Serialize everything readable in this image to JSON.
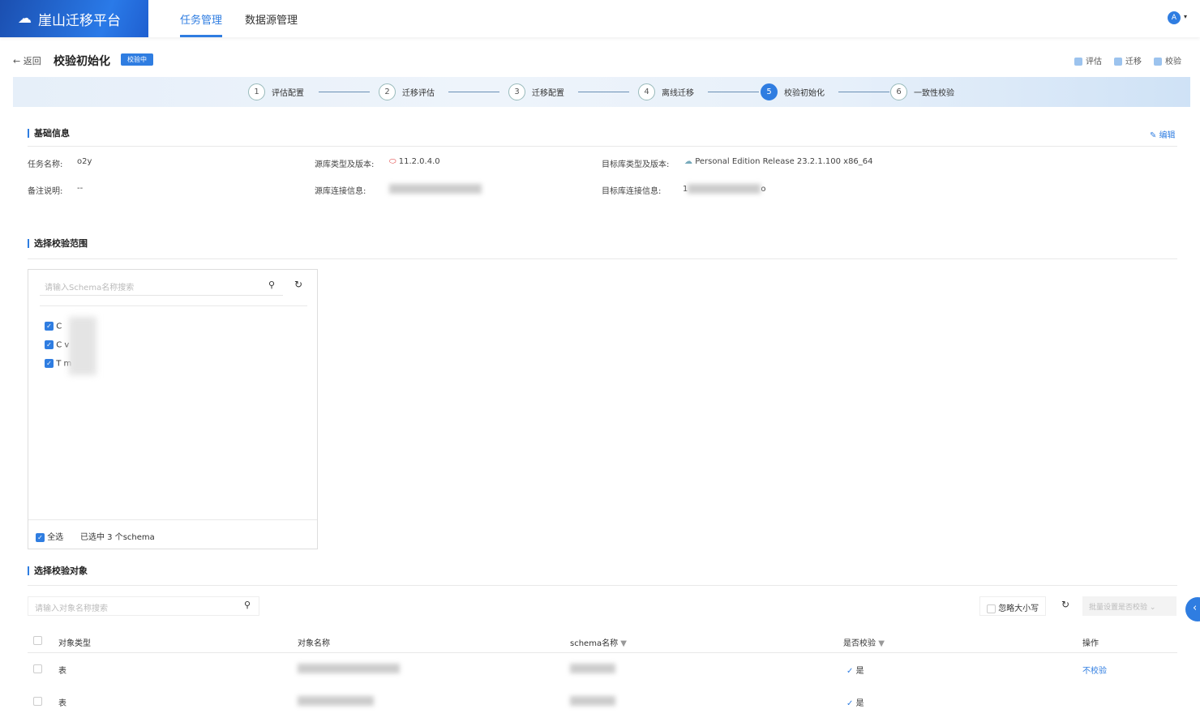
{
  "app": {
    "title": "崖山迁移平台",
    "nav": [
      "任务管理",
      "数据源管理"
    ],
    "avatar": "A"
  },
  "page": {
    "back": "返回",
    "title": "校验初始化",
    "status_tag": "校验中",
    "toggles": [
      "评估",
      "迁移",
      "校验"
    ]
  },
  "steps": [
    {
      "n": "1",
      "label": "评估配置"
    },
    {
      "n": "2",
      "label": "迁移评估"
    },
    {
      "n": "3",
      "label": "迁移配置"
    },
    {
      "n": "4",
      "label": "离线迁移"
    },
    {
      "n": "5",
      "label": "校验初始化"
    },
    {
      "n": "6",
      "label": "一致性校验"
    }
  ],
  "basic": {
    "title": "基础信息",
    "edit": "编辑",
    "task_name_label": "任务名称:",
    "task_name": "o2y",
    "remark_label": "备注说明:",
    "remark": "--",
    "src_type_label": "源库类型及版本:",
    "src_type": "11.2.0.4.0",
    "src_conn_label": "源库连接信息:",
    "dst_type_label": "目标库类型及版本:",
    "dst_type": "Personal Edition Release 23.2.1.100 x86_64",
    "dst_conn_label": "目标库连接信息:",
    "dst_conn_prefix": "1",
    "dst_conn_suffix": "o"
  },
  "scope": {
    "title": "选择校验范围",
    "search_placeholder": "请输入Schema名称搜索",
    "schemas": [
      "C",
      "C    v",
      "T    m"
    ],
    "select_all": "全选",
    "selected": "已选中 3 个schema"
  },
  "objects": {
    "title": "选择校验对象",
    "search_placeholder": "请输入对象名称搜索",
    "ignore_case": "忽略大小写",
    "batch": "批量设置是否校验",
    "columns": [
      "对象类型",
      "对象名称",
      "schema名称",
      "是否校验",
      "操作"
    ],
    "rows": [
      {
        "type": "表",
        "check": "是",
        "action": "不校验"
      },
      {
        "type": "表",
        "check": "是",
        "action": ""
      }
    ]
  },
  "colors": {
    "accent": "#2f7de1"
  }
}
